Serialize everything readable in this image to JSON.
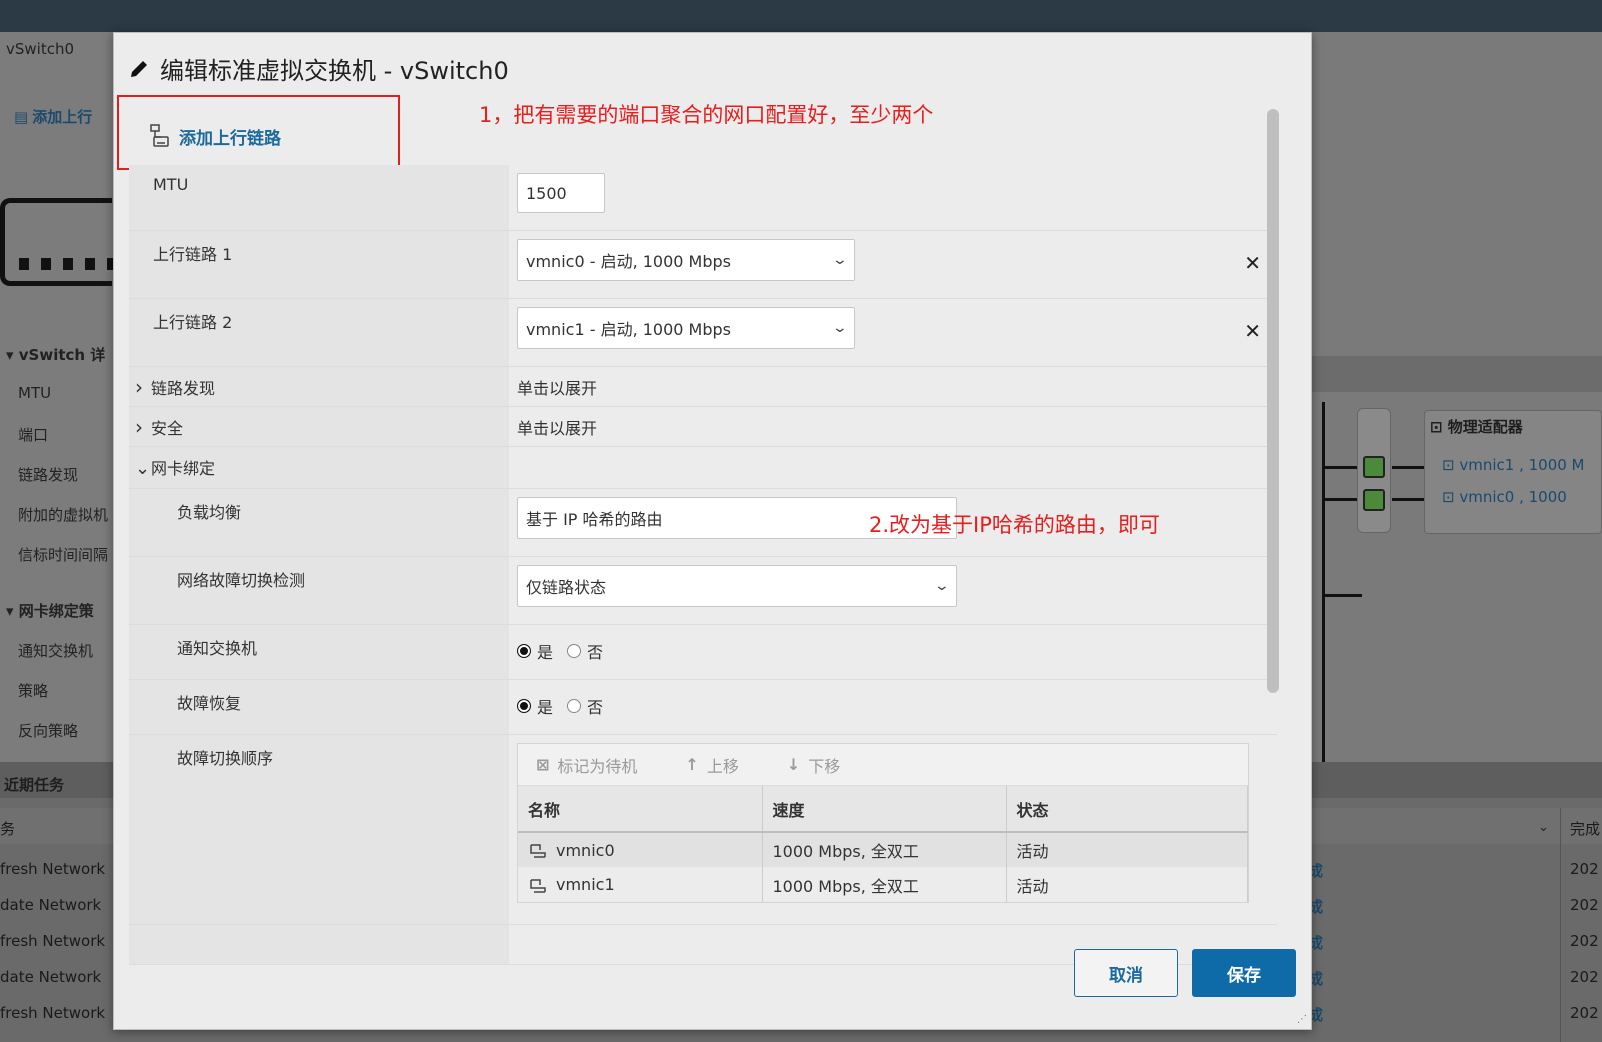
{
  "background": {
    "switch_name": "vSwitch0",
    "add_uplink": "添加上行",
    "details_section": "vSwitch 详",
    "detail_rows": [
      "MTU",
      "端口",
      "链路发现",
      "附加的虚拟机",
      "信标时间间隔"
    ],
    "teaming_section": "网卡绑定策",
    "teaming_rows": [
      "通知交换机",
      "策略",
      "反向策略"
    ],
    "recent_tasks": "近期任务",
    "task_col_partial": "务",
    "tasks": [
      "fresh Network",
      "date Network",
      "fresh Network",
      "date Network",
      "fresh Network"
    ],
    "task_status_partial": "成",
    "task_time_partial": "202",
    "complete_col": "完成",
    "physical_adapters": "物理适配器",
    "phys_items": [
      "vmnic1 , 1000 M",
      "vmnic0 , 1000"
    ]
  },
  "modal": {
    "title": "编辑标准虚拟交换机 - vSwitch0",
    "add_uplink_label": "添加上行链路",
    "annotation_1": "1，把有需要的端口聚合的网口配置好，至少两个",
    "annotation_2": "2.改为基于IP哈希的路由，即可",
    "mtu_label": "MTU",
    "mtu_value": "1500",
    "uplink1_label": "上行链路 1",
    "uplink1_value": "vmnic0 - 启动, 1000 Mbps",
    "uplink2_label": "上行链路 2",
    "uplink2_value": "vmnic1 - 启动, 1000 Mbps",
    "link_discovery_label": "链路发现",
    "link_discovery_value": "单击以展开",
    "security_label": "安全",
    "security_value": "单击以展开",
    "teaming_label": "网卡绑定",
    "load_balance_label": "负载均衡",
    "load_balance_value": "基于 IP 哈希的路由",
    "failure_detection_label": "网络故障切换检测",
    "failure_detection_value": "仅链路状态",
    "notify_switches_label": "通知交换机",
    "failback_label": "故障恢复",
    "yes": "是",
    "no": "否",
    "failover_order_label": "故障切换顺序",
    "mark_standby": "标记为待机",
    "move_up": "上移",
    "move_down": "下移",
    "table_headers": [
      "名称",
      "速度",
      "状态"
    ],
    "table_rows": [
      {
        "name": "vmnic0",
        "speed": "1000 Mbps, 全双工",
        "status": "活动"
      },
      {
        "name": "vmnic1",
        "speed": "1000 Mbps, 全双工",
        "status": "活动"
      }
    ],
    "cancel": "取消",
    "save": "保存"
  },
  "colors": {
    "accent": "#0f6aa8",
    "annotation": "#e81d1d",
    "link": "#1a6a9e"
  }
}
